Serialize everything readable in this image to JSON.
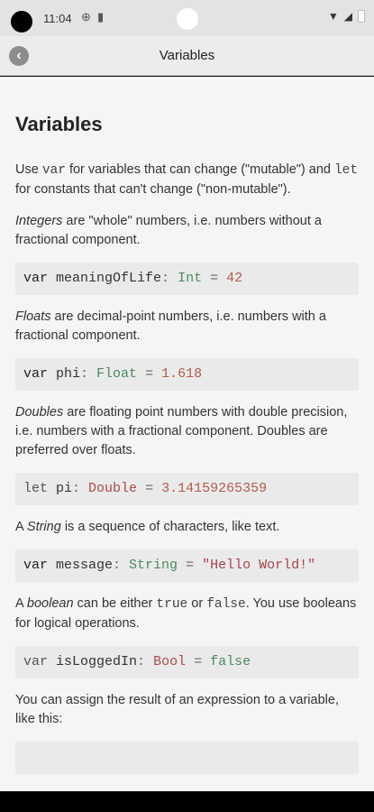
{
  "status_bar": {
    "time": "11:04"
  },
  "nav": {
    "title": "Variables"
  },
  "content": {
    "heading": "Variables",
    "intro": {
      "t1": "Use ",
      "code1": "var",
      "t2": " for variables that can change (\"mutable\") and ",
      "code2": "let",
      "t3": " for constants that can't change (\"non-mutable\")."
    },
    "integers": {
      "em": "Integers",
      "rest": " are \"whole\" numbers, i.e. numbers without a fractional component."
    },
    "code_int": {
      "kw": "var",
      "name": " meaningOfLife",
      "colon": ":",
      "type": " Int",
      "eq": " = ",
      "value": "42"
    },
    "floats": {
      "em": "Floats",
      "rest": " are decimal-point numbers, i.e. numbers with a fractional component."
    },
    "code_float": {
      "kw": "var",
      "name": " phi",
      "colon": ":",
      "type": " Float",
      "eq": " = ",
      "value": "1.618"
    },
    "doubles": {
      "em": "Doubles",
      "rest": " are floating point numbers with double precision, i.e. numbers with a fractional component. Doubles are preferred over floats."
    },
    "code_double": {
      "kw": "let",
      "name": " pi",
      "colon": ":",
      "type": " Double",
      "eq": " = ",
      "value": "3.14159265359"
    },
    "strings": {
      "t1": "A ",
      "em": "String",
      "rest": " is a sequence of characters, like text."
    },
    "code_string": {
      "kw": "var",
      "name": " message",
      "colon": ":",
      "type": " String",
      "eq": " = ",
      "value": "\"Hello World!\""
    },
    "booleans": {
      "t1": "A ",
      "em": "boolean",
      "t2": " can be either ",
      "code1": "true",
      "t3": " or ",
      "code2": "false",
      "t4": ". You use booleans for logical operations."
    },
    "code_bool": {
      "kw": "var",
      "name": " isLoggedIn",
      "colon": ":",
      "type": " Bool",
      "eq": " = ",
      "value": "false"
    },
    "expression": "You can assign the result of an expression to a variable, like this:"
  }
}
